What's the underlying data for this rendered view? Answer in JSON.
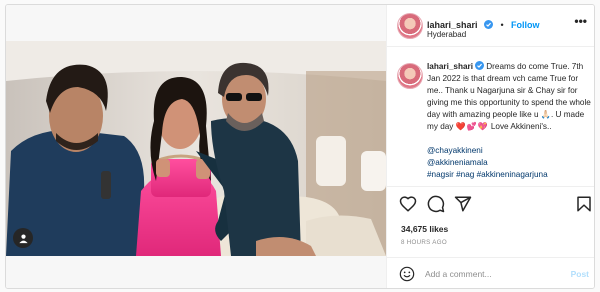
{
  "post": {
    "username": "lahari_shari",
    "follow_label": "Follow",
    "header_separator": "•",
    "location": "Hyderabad",
    "more_label": "•••",
    "caption_text": "Dreams do come True. 7th Jan 2022 is that dream vch came True for me.. Thank u Nagarjuna sir & Chay sir for giving me this opportunity to spend the whole day with amazing people like u 🙏🏻. U made my day ",
    "caption_hearts": "❤️💕💖",
    "caption_tail": " Love Akkineni's..",
    "mentions": [
      "@chayakkineni",
      "@akkineniamala",
      "#nagsir #nag #akkineninagarjuna"
    ],
    "likes": "34,675 likes",
    "time_ago": "8 HOURS AGO",
    "comment_placeholder": "Add a comment...",
    "post_label": "Post"
  },
  "icons": {
    "verified": "verified-badge-icon",
    "more": "more-options-icon",
    "like": "heart-icon",
    "comment": "comment-bubble-icon",
    "share": "paper-plane-icon",
    "save": "bookmark-icon",
    "tag": "user-tag-icon",
    "emoji": "smiley-icon"
  },
  "colors": {
    "accent": "#0095f6",
    "verified": "#3897f0",
    "text": "#262626",
    "muted": "#8e8e8e",
    "mention": "#00376b",
    "post_disabled": "#b2dffc"
  }
}
